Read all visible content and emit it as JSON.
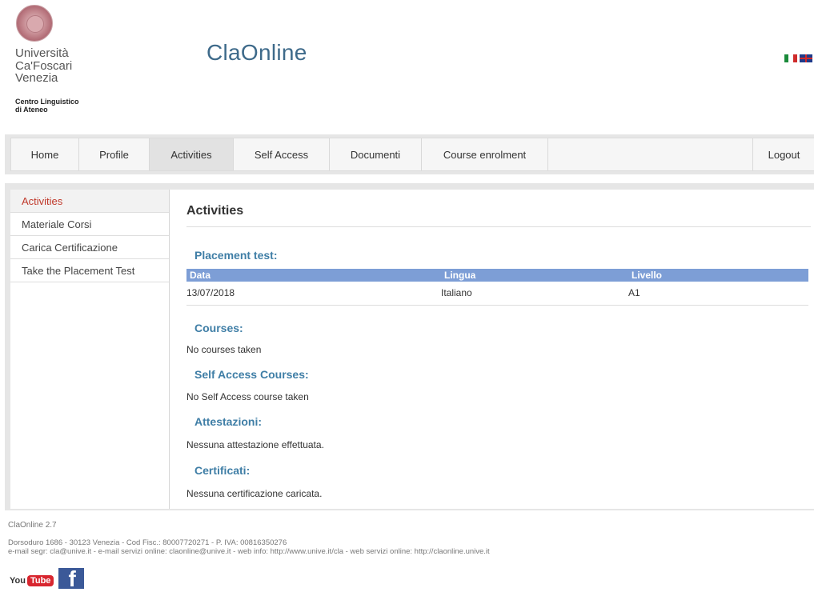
{
  "header": {
    "university_lines": [
      "Università",
      "Ca'Foscari",
      "Venezia"
    ],
    "centro_lines": [
      "Centro Linguistico",
      "di Ateneo"
    ],
    "app_title": "ClaOnline"
  },
  "nav": {
    "items": [
      {
        "label": "Home",
        "width": 85
      },
      {
        "label": "Profile",
        "width": 88
      },
      {
        "label": "Activities",
        "width": 105,
        "active": true
      },
      {
        "label": "Self Access",
        "width": 120
      },
      {
        "label": "Documenti",
        "width": 115
      },
      {
        "label": "Course enrolment",
        "width": 158
      }
    ],
    "logout": "Logout"
  },
  "sidebar": {
    "items": [
      {
        "label": "Activities",
        "active": true
      },
      {
        "label": "Materiale Corsi"
      },
      {
        "label": "Carica Certificazione"
      },
      {
        "label": "Take the Placement Test"
      }
    ]
  },
  "main": {
    "title": "Activities",
    "placement": {
      "title": "Placement test:",
      "columns": [
        "Data",
        "Lingua",
        "Livello"
      ],
      "rows": [
        [
          "13/07/2018",
          "Italiano",
          "A1"
        ]
      ]
    },
    "courses": {
      "title": "Courses:",
      "text": "No courses taken"
    },
    "self_access": {
      "title": "Self Access Courses:",
      "text": "No Self Access course taken"
    },
    "attestazioni": {
      "title": "Attestazioni:",
      "text": "Nessuna attestazione effettuata."
    },
    "certificati": {
      "title": "Certificati:",
      "text": "Nessuna certificazione caricata."
    }
  },
  "footer": {
    "version": "ClaOnline 2.7",
    "address_line1": "Dorsoduro 1686 - 30123 Venezia - Cod Fisc.: 80007720271 - P. IVA: 00816350276",
    "address_line2": "e-mail segr: cla@unive.it - e-mail servizi online: claonline@unive.it - web info: http://www.unive.it/cla - web servizi online: http://claonline.unive.it",
    "youtube_you": "You",
    "youtube_tube": "Tube",
    "facebook_glyph": "f"
  },
  "colors": {
    "accent_title": "#3e6a8a",
    "section_title": "#3f7ea6",
    "table_header": "#7d9ed6",
    "sidebar_active": "#c0392b"
  }
}
